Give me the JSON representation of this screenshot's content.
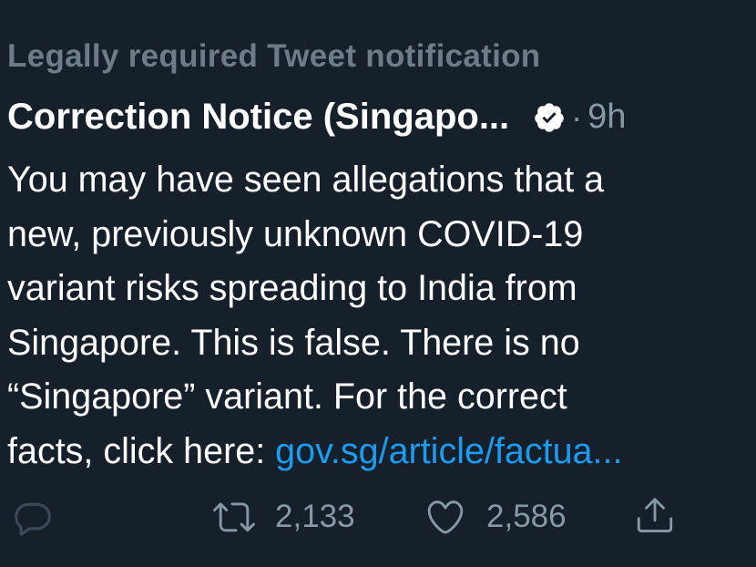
{
  "notice_label": "Legally required Tweet notification",
  "tweet": {
    "author_name": "Correction Notice (Singapo...",
    "time_separator": "·",
    "timestamp": "9h",
    "body_lines": [
      "You may have seen allegations that a",
      "new, previously unknown COVID-19",
      "variant risks spreading to India from",
      "Singapore. This is false. There is no",
      "“Singapore” variant. For the correct"
    ],
    "last_line_text": "facts, click here: ",
    "link_text": "gov.sg/article/factua..."
  },
  "actions": {
    "retweet_count": "2,133",
    "like_count": "2,586"
  },
  "icons": {
    "reply": "reply-icon",
    "retweet": "retweet-icon",
    "like": "heart-icon",
    "share": "share-icon",
    "verified": "verified-badge-icon"
  },
  "colors": {
    "background": "#15202b",
    "muted": "#8899a6",
    "link": "#1d9bf0"
  }
}
